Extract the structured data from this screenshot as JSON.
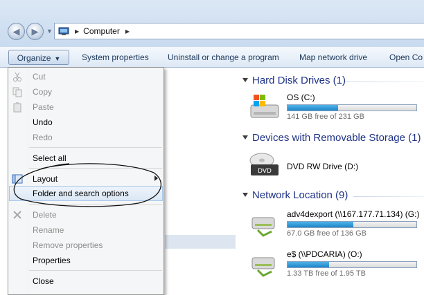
{
  "address": {
    "breadcrumb": [
      "Computer"
    ]
  },
  "toolbar": {
    "organize": "Organize",
    "system_properties": "System properties",
    "uninstall": "Uninstall or change a program",
    "map_drive": "Map network drive",
    "open_control": "Open Co"
  },
  "menu": {
    "cut": "Cut",
    "copy": "Copy",
    "paste": "Paste",
    "undo": "Undo",
    "redo": "Redo",
    "select_all": "Select all",
    "layout": "Layout",
    "folder_options": "Folder and search options",
    "delete": "Delete",
    "rename": "Rename",
    "remove_properties": "Remove properties",
    "properties": "Properties",
    "close": "Close"
  },
  "groups": {
    "hdd": {
      "title": "Hard Disk Drives (1)",
      "drives": [
        {
          "label": "OS (C:)",
          "free": "141 GB free of 231 GB",
          "used_fraction": 0.39
        }
      ]
    },
    "removable": {
      "title": "Devices with Removable Storage (1)",
      "drives": [
        {
          "label": "DVD RW Drive (D:)"
        }
      ]
    },
    "network": {
      "title": "Network Location (9)",
      "drives": [
        {
          "label": "adv4dexport (\\\\167.177.71.134) (G:)",
          "free": "67.0 GB free of 136 GB",
          "used_fraction": 0.51
        },
        {
          "label": "e$ (\\\\PDCARIA) (O:)",
          "free": "1.33 TB free of 1.95 TB",
          "used_fraction": 0.32
        }
      ]
    }
  },
  "colors": {
    "group_title": "#1e3287",
    "bar_fill": "#1f86c9",
    "toolbar_text": "#1e395b"
  }
}
